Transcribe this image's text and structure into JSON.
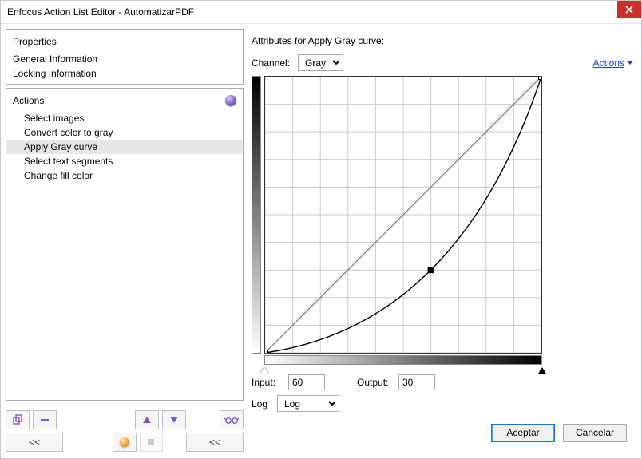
{
  "title": "Enfocus Action List Editor - AutomatizarPDF",
  "left": {
    "properties": {
      "head": "Properties",
      "items": [
        "General Information",
        "Locking Information"
      ]
    },
    "actions": {
      "head": "Actions",
      "items": [
        "Select images",
        "Convert color to gray",
        "Apply Gray curve",
        "Select text segments",
        "Change fill color"
      ],
      "selected_index": 2
    },
    "toolbar": {
      "prev_btn": "<<",
      "prev_btn2": "<<"
    }
  },
  "right": {
    "attributes_title": "Attributes for Apply Gray curve:",
    "channel_label": "Channel:",
    "channel_value": "Gray",
    "actions_link": "Actions",
    "input_label": "Input:",
    "input_value": "60",
    "output_label": "Output:",
    "output_value": "30",
    "log_label": "Log",
    "log_value": "Log"
  },
  "footer": {
    "accept": "Aceptar",
    "cancel": "Cancelar"
  },
  "chart_data": {
    "type": "line",
    "title": "",
    "xlabel": "",
    "ylabel": "",
    "xlim": [
      0,
      100
    ],
    "ylim": [
      0,
      100
    ],
    "grid": true,
    "series": [
      {
        "name": "reference",
        "x": [
          0,
          100
        ],
        "y": [
          0,
          100
        ]
      },
      {
        "name": "curve",
        "control_points": [
          {
            "x": 0,
            "y": 0
          },
          {
            "x": 60,
            "y": 30
          },
          {
            "x": 100,
            "y": 100
          }
        ]
      }
    ]
  }
}
